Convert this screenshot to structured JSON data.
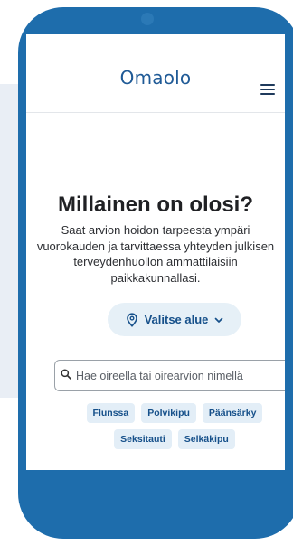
{
  "header": {
    "logo": "Omaolo",
    "menu_icon": "hamburger-menu-icon"
  },
  "main": {
    "title": "Millainen on olosi?",
    "description": "Saat arvion hoidon tarpeesta ympäri vuorokauden ja tarvittaessa yhteyden julkisen terveydenhuollon ammattilaisiin paikkakunnallasi.",
    "region_button": {
      "label": "Valitse alue",
      "icon": "location-pin-icon",
      "chevron": "chevron-down-icon"
    },
    "search": {
      "placeholder": "Hae oireella tai oirearvion nimellä",
      "value": "",
      "icon": "search-icon"
    },
    "chips": [
      "Flunssa",
      "Polvikipu",
      "Päänsärky",
      "Seksitauti",
      "Selkäkipu"
    ]
  },
  "colors": {
    "phone": "#1e6dac",
    "brand": "#1f5a96",
    "chip_bg": "#e3eef7",
    "button_bg": "#e6f0f7"
  }
}
